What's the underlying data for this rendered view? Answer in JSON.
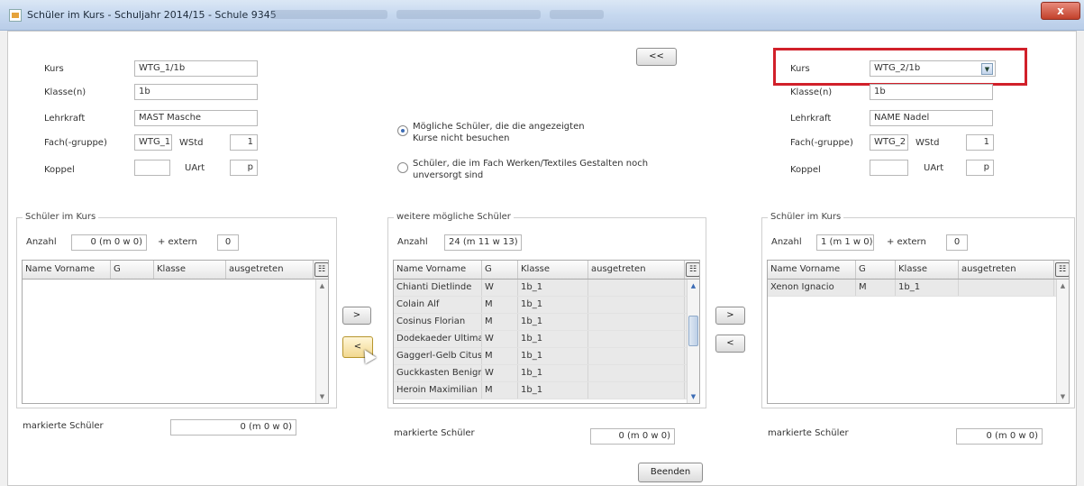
{
  "window": {
    "title": "Schüler im Kurs - Schuljahr 2014/15 - Schule 9345",
    "close": "x"
  },
  "left": {
    "kurs_label": "Kurs",
    "kurs": "WTG_1/1b",
    "klasse_label": "Klasse(n)",
    "klasse": "1b",
    "lehrkraft_label": "Lehrkraft",
    "lehrkraft": "MAST Masche",
    "fach_label": "Fach(-gruppe)",
    "fach": "WTG_1",
    "wstd_label": "WStd",
    "wstd": "1",
    "koppel_label": "Koppel",
    "koppel": "",
    "uart_label": "UArt",
    "uart": "p",
    "group_title": "Schüler im Kurs",
    "anzahl_label": "Anzahl",
    "anzahl": "0 (m 0 w 0)",
    "extern_label": "+ extern",
    "extern": "0",
    "columns": [
      "Name Vorname",
      "G",
      "Klasse",
      "ausgetreten"
    ],
    "sort_indicator": "▲",
    "marked_label": "markierte Schüler",
    "marked": "0 (m 0 w 0)"
  },
  "middle": {
    "back_button": "<<",
    "radio1": "Mögliche Schüler, die die angezeigten Kurse nicht besuchen",
    "radio2": "Schüler, die im Fach Werken/Textiles Gestalten noch unversorgt sind",
    "group_title": "weitere mögliche Schüler",
    "anzahl_label": "Anzahl",
    "anzahl": "24 (m 11 w 13)",
    "columns": [
      "Name Vorname",
      "G",
      "Klasse",
      "ausgetreten"
    ],
    "sort_indicator": "▲",
    "rows": [
      {
        "name": "Chianti Dietlinde",
        "g": "W",
        "klasse": "1b_1",
        "ausgetreten": ""
      },
      {
        "name": "Colain Alf",
        "g": "M",
        "klasse": "1b_1",
        "ausgetreten": ""
      },
      {
        "name": "Cosinus Florian",
        "g": "M",
        "klasse": "1b_1",
        "ausgetreten": ""
      },
      {
        "name": "Dodekaeder Ultima",
        "g": "W",
        "klasse": "1b_1",
        "ausgetreten": ""
      },
      {
        "name": "Gaggerl-Gelb Citus",
        "g": "M",
        "klasse": "1b_1",
        "ausgetreten": ""
      },
      {
        "name": "Guckkasten Benigna",
        "g": "W",
        "klasse": "1b_1",
        "ausgetreten": ""
      },
      {
        "name": "Heroin Maximilian",
        "g": "M",
        "klasse": "1b_1",
        "ausgetreten": ""
      }
    ],
    "marked_label": "markierte Schüler",
    "marked": "0 (m 0 w 0)",
    "beenden": "Beenden"
  },
  "right": {
    "kurs_label": "Kurs",
    "kurs": "WTG_2/1b",
    "klasse_label": "Klasse(n)",
    "klasse": "1b",
    "lehrkraft_label": "Lehrkraft",
    "lehrkraft": "NAME Nadel",
    "fach_label": "Fach(-gruppe)",
    "fach": "WTG_2",
    "wstd_label": "WStd",
    "wstd": "1",
    "koppel_label": "Koppel",
    "koppel": "",
    "uart_label": "UArt",
    "uart": "p",
    "group_title": "Schüler im Kurs",
    "anzahl_label": "Anzahl",
    "anzahl": "1 (m 1 w 0)",
    "extern_label": "+ extern",
    "extern": "0",
    "columns": [
      "Name Vorname",
      "G",
      "Klasse",
      "ausgetreten"
    ],
    "sort_indicator": "▲",
    "rows": [
      {
        "name": "Xenon Ignacio",
        "g": "M",
        "klasse": "1b_1",
        "ausgetreten": ""
      }
    ],
    "marked_label": "markierte Schüler",
    "marked": "0 (m 0 w 0)"
  },
  "arrows": {
    "to_left_add": ">",
    "to_left_remove": "<",
    "to_right_add": ">",
    "to_right_remove": "<"
  },
  "icons": {
    "combo": "chevron-down-icon",
    "column_chooser": "column-chooser-icon"
  },
  "colors": {
    "highlight": "#d1202a"
  }
}
